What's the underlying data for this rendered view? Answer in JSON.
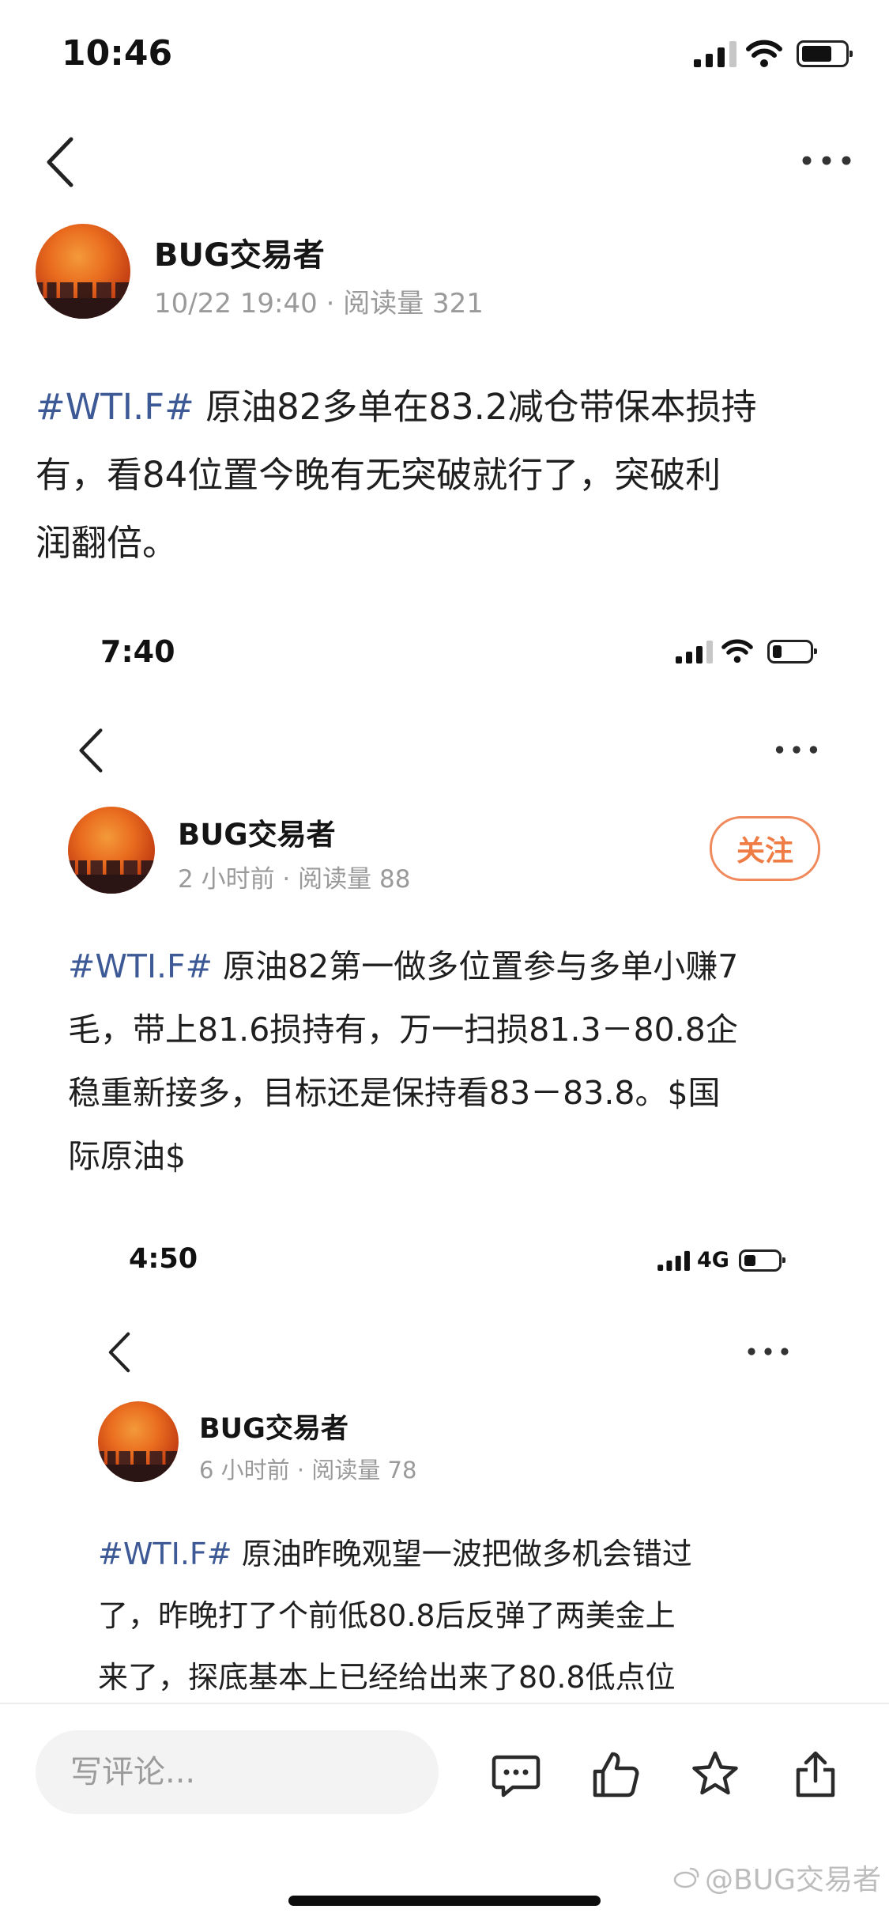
{
  "screens": [
    {
      "time": "10:46",
      "author": "BUG交易者",
      "meta": "10/22 19:40 · 阅读量 321",
      "post_tag": "#WTI.F#",
      "post_line1_rest": " 原油82多单在83.2减仓带保本损持",
      "post_line2": "有，看84位置今晚有无突破就行了，突破利",
      "post_line3": "润翻倍。"
    },
    {
      "time": "7:40",
      "author": "BUG交易者",
      "meta": "2 小时前 · 阅读量 88",
      "follow_label": "关注",
      "post_tag": "#WTI.F#",
      "post_line1_rest": " 原油82第一做多位置参与多单小赚7",
      "post_line2": "毛，带上81.6损持有，万一扫损81.3－80.8企",
      "post_line3": "稳重新接多，目标还是保持看83－83.8。$国",
      "post_line4": "际原油$"
    },
    {
      "time": "4:50",
      "network": "4G",
      "author": "BUG交易者",
      "meta": "6 小时前 · 阅读量 78",
      "post_tag": "#WTI.F#",
      "post_line1_rest": " 原油昨晚观望一波把做多机会错过",
      "post_line2": "了，昨晚打了个前低80.8后反弹了两美金上",
      "post_line3": "来了，探底基本上已经给出来了80.8低点位"
    }
  ],
  "bottom_bar": {
    "comment_placeholder": "写评论...",
    "icons": [
      "comment-icon",
      "like-icon",
      "star-icon",
      "share-icon"
    ]
  },
  "watermark": "@BUG交易者",
  "colors": {
    "tag_blue": "#3d5a96",
    "follow_orange": "#f07c45",
    "meta_gray": "#9a9a9a"
  }
}
